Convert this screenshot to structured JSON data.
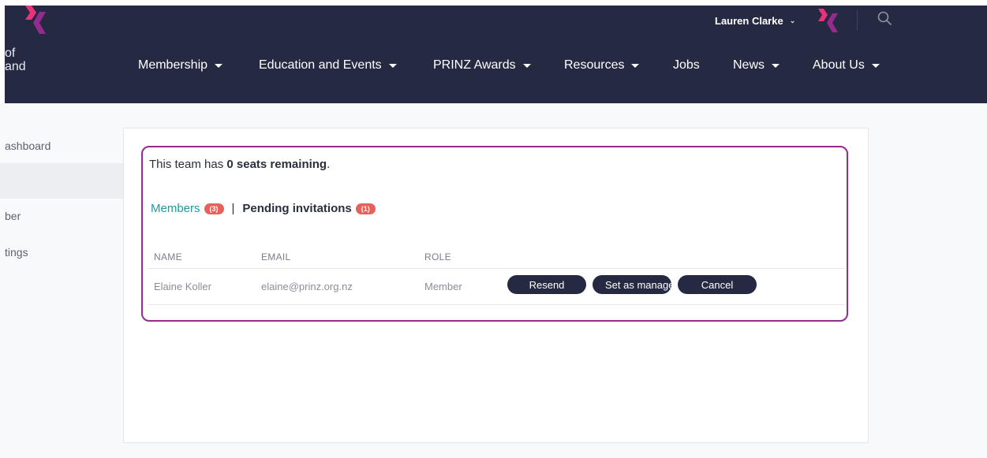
{
  "header": {
    "logo_text": "of\nand",
    "user_name": "Lauren Clarke",
    "colors": {
      "background": "#252a42",
      "brand_pink": "#e8337a",
      "brand_purple": "#942c8f"
    }
  },
  "nav": {
    "items": [
      {
        "label": "Membership",
        "has_dropdown": true
      },
      {
        "label": "Education and Events",
        "has_dropdown": true
      },
      {
        "label": "PRINZ Awards",
        "has_dropdown": true
      },
      {
        "label": "Resources",
        "has_dropdown": true
      },
      {
        "label": "Jobs",
        "has_dropdown": false
      },
      {
        "label": "News",
        "has_dropdown": true
      },
      {
        "label": "About Us",
        "has_dropdown": true
      }
    ]
  },
  "sidebar": {
    "items": [
      {
        "label": "ashboard",
        "active": false
      },
      {
        "label": "",
        "active": true
      },
      {
        "label": "ber",
        "active": false
      },
      {
        "label": "tings",
        "active": false
      }
    ]
  },
  "team": {
    "seats_prefix": "This team has ",
    "seats_bold": "0 seats remaining",
    "seats_suffix": ".",
    "tabs": {
      "members_label": "Members",
      "members_count": "(3)",
      "separator": "|",
      "pending_label": "Pending invitations",
      "pending_count": "(1)"
    },
    "table": {
      "headers": [
        "NAME",
        "EMAIL",
        "ROLE"
      ],
      "rows": [
        {
          "name": "Elaine Koller",
          "email": "elaine@prinz.org.nz",
          "role": "Member",
          "actions": [
            "Resend",
            "Set as manager",
            "Cancel"
          ]
        }
      ]
    }
  }
}
